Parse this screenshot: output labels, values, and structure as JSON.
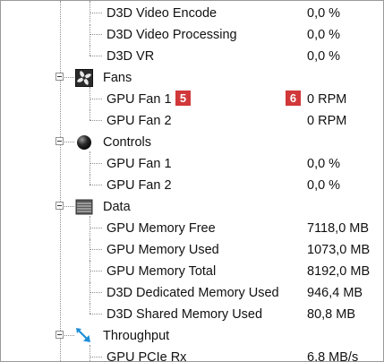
{
  "rows": {
    "video_encode": {
      "label": "D3D Video Encode",
      "value": "0,0 %"
    },
    "video_processing": {
      "label": "D3D Video Processing",
      "value": "0,0 %"
    },
    "vr": {
      "label": "D3D VR",
      "value": "0,0 %"
    },
    "fans": {
      "label": "Fans"
    },
    "fan1": {
      "label": "GPU Fan 1",
      "value": "0 RPM"
    },
    "fan2": {
      "label": "GPU Fan 2",
      "value": "0 RPM"
    },
    "controls": {
      "label": "Controls"
    },
    "ctrl_fan1": {
      "label": "GPU Fan 1",
      "value": "0,0 %"
    },
    "ctrl_fan2": {
      "label": "GPU Fan 2",
      "value": "0,0 %"
    },
    "data": {
      "label": "Data"
    },
    "mem_free": {
      "label": "GPU Memory Free",
      "value": "7118,0 MB"
    },
    "mem_used": {
      "label": "GPU Memory Used",
      "value": "1073,0 MB"
    },
    "mem_total": {
      "label": "GPU Memory Total",
      "value": "8192,0 MB"
    },
    "d3d_dedicated": {
      "label": "D3D Dedicated Memory Used",
      "value": "946,4 MB"
    },
    "d3d_shared": {
      "label": "D3D Shared Memory Used",
      "value": "80,8 MB"
    },
    "throughput": {
      "label": "Throughput"
    },
    "pcie_rx": {
      "label": "GPU PCIe Rx",
      "value": "6,8 MB/s"
    }
  },
  "badges": {
    "label_badge": "5",
    "value_badge": "6"
  },
  "icons": {
    "fans": "fan-icon",
    "controls": "controls-knob-icon",
    "data": "data-table-icon",
    "throughput": "throughput-arrows-icon"
  },
  "colors": {
    "badge": "#d1383a",
    "throughput_icon": "#1e8fd8"
  }
}
